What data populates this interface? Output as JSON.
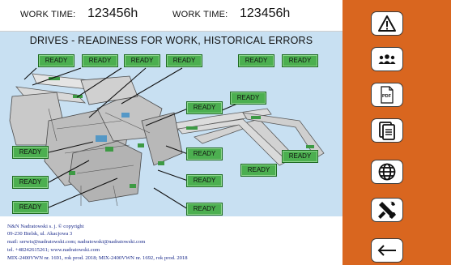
{
  "header": {
    "work_time_label_1": "WORK TIME:",
    "work_time_value_1": "123456h",
    "work_time_label_2": "WORK TIME:",
    "work_time_value_2": "123456h"
  },
  "diagram": {
    "title": "DRIVES - READINESS FOR WORK, HISTORICAL ERRORS",
    "ready_label": "READY",
    "ready_color": "#4caf50"
  },
  "footer": {
    "line1": "N&N Nadratowski s. j.   © copyright",
    "line2": "09-230 Bielsk, ul. Akacjowa 3",
    "line3": "mail: serwis@nadratowski.com;  nadratowski@nadratowski.com",
    "line4": "tel. +48242615261;  www.nadratowski.com",
    "line5": "MIX-2400VWN nr. 1691, rok prod. 2018;  MIX-2400VWN nr. 1692, rok prod. 2018"
  },
  "sidebar": {
    "background": "#d9661f",
    "buttons": [
      {
        "icon": "warning-icon"
      },
      {
        "icon": "team-icon"
      },
      {
        "icon": "pdf-icon"
      },
      {
        "icon": "documents-icon"
      },
      {
        "icon": "globe-icon"
      },
      {
        "icon": "tools-icon"
      },
      {
        "icon": "back-arrow-icon"
      }
    ],
    "pdf_text": "PDF"
  }
}
